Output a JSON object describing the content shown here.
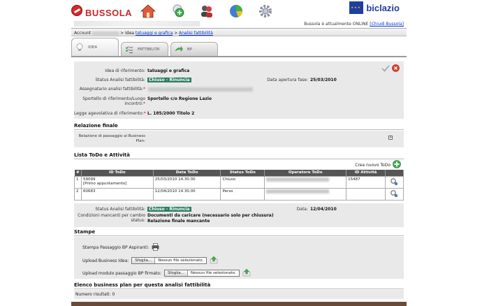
{
  "header": {
    "logo_text": "BUSSOLA",
    "brand": "biclazio",
    "online_text": "Bussola è attualmente ONLINE",
    "close_link": "[Chiudi Bussola]"
  },
  "breadcrumb": {
    "root": "Account",
    "sep1": ">",
    "idea": "Idea",
    "idea_name": "tatuaggi e grafica",
    "sep2": ">",
    "current": "Analisi fattibilità"
  },
  "tabs": [
    {
      "label": "IDEA"
    },
    {
      "label": "FATTIBILITA'"
    },
    {
      "label": "BP"
    }
  ],
  "form": {
    "idea_label": "Idea di riferimento:",
    "idea_value": "tatuaggi e grafica",
    "status_label": "Status Analisi fattibilità:",
    "status_value": "Chiuso - Rinuncia",
    "apertura_label": "Data apertura fase:",
    "apertura_value": "25/03/2010",
    "assegnatario_label": "Assegnatario analisi fattibilità:",
    "sportello_label": "Sportello di riferimento/Luogo incontro:",
    "sportello_value": "Sportello c/o Regione Lazio",
    "legge_label": "Legge agevolativa di riferimento:",
    "legge_value": "L. 185/2000 Titolo 2",
    "required_mark": "*"
  },
  "relazione": {
    "title": "Relazione finale",
    "passaggio_label": "Relazione di passaggio al Business Plan:"
  },
  "todo": {
    "title": "Lista ToDo e Attività",
    "new_button": "Crea nuovo ToDo",
    "columns": [
      "#",
      "ID ToDo",
      "Data ToDo",
      "Status ToDo",
      "Operatore ToDo",
      "ID Attività",
      ""
    ],
    "rows": [
      {
        "n": "1",
        "id": "59099",
        "sub": "[Primo appuntamento]",
        "data": "25/03/2010 14.30.00",
        "status": "Chiuso",
        "attivita": "15487"
      },
      {
        "n": "2",
        "id": "60683",
        "sub": "",
        "data": "12/04/2010 14.30.00",
        "status": "Perso",
        "attivita": ""
      }
    ]
  },
  "summary": {
    "status_label": "Status Analisi fattibilità:",
    "status_value": "Chiuso - Rinuncia",
    "data_label": "Data:",
    "data_value": "12/04/2010",
    "condizioni_label": "Condizioni mancanti per cambio status:",
    "condizioni_value1": "Documenti da caricare (necessario solo per chiusura)",
    "condizioni_value2": "Relazione finale mancante"
  },
  "stampe": {
    "title": "Stampe",
    "stampa_label": "Stampa Passaggio BP Aspiranti:",
    "upload_idea_label": "Upload Business Idea:",
    "upload_bp_label": "Upload modulo passaggio BP firmato:",
    "browse": "Sfoglia...",
    "no_file": "Nessun file selezionato."
  },
  "elenco": {
    "title": "Elenco business plan per questa analisi fattibilità",
    "count": "Numero risultati: 0"
  },
  "colors": {
    "status_badge": "#2b7d5e",
    "accent_red": "#c62828",
    "brand_blue": "#1f3fa0",
    "table_head": "#555555"
  }
}
